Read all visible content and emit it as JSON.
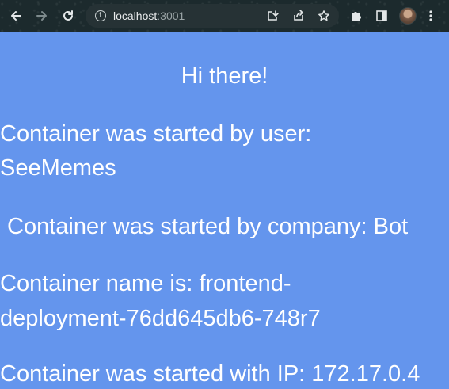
{
  "browser": {
    "url_host": "localhost",
    "url_port": ":3001"
  },
  "page": {
    "greeting": "Hi there!",
    "user_label": "Container was started by user:",
    "user_value": "SeeMemes",
    "company_line": "Container was started by company: Bot",
    "name_label": "Container name is: frontend-",
    "name_value": "deployment-76dd645db6-748r7",
    "ip_line": "Container was started with IP: 172.17.0.4"
  },
  "colors": {
    "page_background": "#6495ed",
    "toolbar_background": "#1c2a2d",
    "text": "#ffffff"
  }
}
